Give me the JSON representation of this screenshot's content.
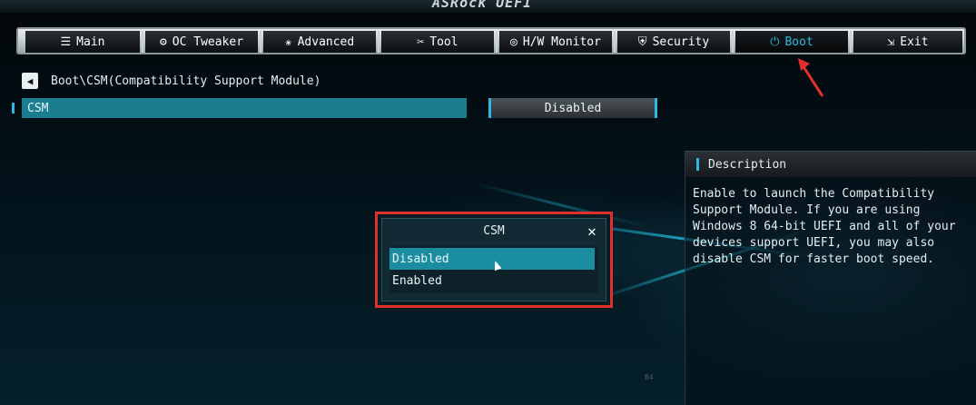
{
  "brand": {
    "logo_text": "ASRock UEFI"
  },
  "nav": {
    "tabs": [
      {
        "label": "Main",
        "icon": "list-icon"
      },
      {
        "label": "OC Tweaker",
        "icon": "rocket-icon"
      },
      {
        "label": "Advanced",
        "icon": "star-icon"
      },
      {
        "label": "Tool",
        "icon": "tools-icon"
      },
      {
        "label": "H/W Monitor",
        "icon": "gauge-icon"
      },
      {
        "label": "Security",
        "icon": "shield-icon"
      },
      {
        "label": "Boot",
        "icon": "power-icon",
        "active": true
      },
      {
        "label": "Exit",
        "icon": "exit-icon"
      }
    ]
  },
  "breadcrumb": {
    "path": "Boot\\CSM(Compatibility Support Module)"
  },
  "setting": {
    "label": "CSM",
    "value": "Disabled"
  },
  "description": {
    "title": "Description",
    "text": "Enable to launch the Compatibility\nSupport Module. If you are using\nWindows 8 64-bit UEFI and all of your\ndevices support UEFI, you may also\ndisable CSM for faster boot speed."
  },
  "dialog": {
    "title": "CSM",
    "close_symbol": "✕",
    "options": [
      {
        "label": "Disabled",
        "selected": true
      },
      {
        "label": "Enabled",
        "selected": false
      }
    ]
  },
  "footer": {
    "page_number": "B4"
  },
  "colors": {
    "accent": "#2fb9e2",
    "highlight": "#1a7e90",
    "annotation": "#e0302b"
  }
}
